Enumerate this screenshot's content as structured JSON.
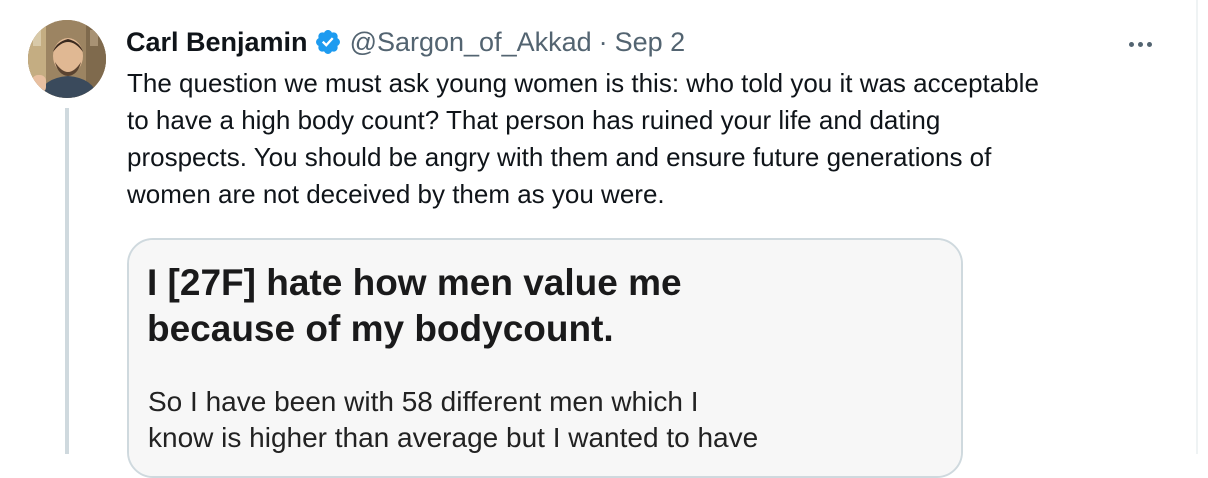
{
  "tweet": {
    "author_name": "Carl Benjamin",
    "handle": "@Sargon_of_Akkad",
    "separator": "·",
    "date": "Sep 2",
    "more_icon": "more-horizontal-icon",
    "verified_icon": "verified-badge-icon",
    "text_lines": [
      "The question we must ask young women is this: who told you it was acceptable",
      "to have a high body count? That person has ruined your life and dating",
      "prospects. You should be angry with them and ensure future generations of",
      "women are not deceived by them as you were."
    ]
  },
  "media": {
    "title_lines": [
      "I [27F] hate how men value me",
      "because of my bodycount."
    ],
    "body_lines": [
      "So I have been with 58 different men which I",
      "know is higher than average but I wanted to have"
    ]
  },
  "colors": {
    "text_primary": "#0f1419",
    "text_secondary": "#536471",
    "verified_blue": "#1d9bf0",
    "thread_line": "#cfd9de",
    "card_border": "#cfd9de"
  }
}
